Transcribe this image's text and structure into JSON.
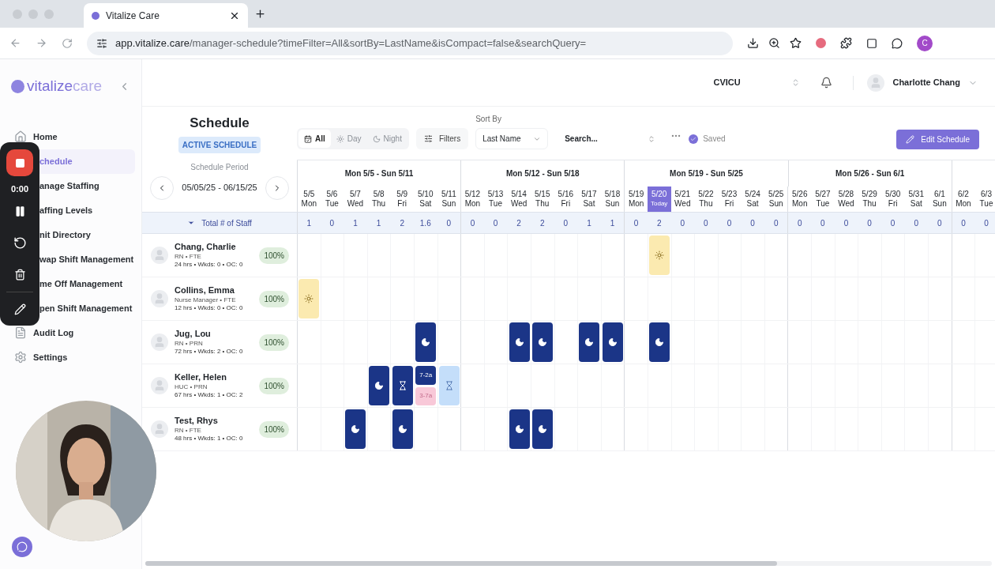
{
  "browser": {
    "tab_title": "Vitalize Care",
    "url_host": "app.vitalize.care",
    "url_path": "/manager-schedule?timeFilter=All&sortBy=LastName&isCompact=false&searchQuery=",
    "profile_initial": "C"
  },
  "sidebar": {
    "logo_main": "vitalize",
    "logo_accent": "care",
    "items": [
      {
        "label": "Home",
        "selected": false,
        "covered": false
      },
      {
        "label": "chedule",
        "selected": true,
        "covered": true
      },
      {
        "label": "anage Staffing",
        "selected": false,
        "covered": true
      },
      {
        "label": "affing Levels",
        "selected": false,
        "covered": true
      },
      {
        "label": "nit Directory",
        "selected": false,
        "covered": true
      },
      {
        "label": "wap Shift Management",
        "selected": false,
        "covered": true
      },
      {
        "label": "me Off Management",
        "selected": false,
        "covered": true
      },
      {
        "label": "pen Shift Management",
        "selected": false,
        "covered": true
      },
      {
        "label": "Audit Log",
        "selected": false,
        "covered": false
      },
      {
        "label": "Settings",
        "selected": false,
        "covered": false
      }
    ]
  },
  "recorder": {
    "timer": "0:00"
  },
  "topbar": {
    "unit": "CVICU",
    "user": "Charlotte Chang"
  },
  "schedule": {
    "title": "Schedule",
    "badge": "ACTIVE SCHEDULE",
    "period_label": "Schedule Period",
    "period": "05/05/25 - 06/15/25"
  },
  "toolbar": {
    "time_filters": [
      {
        "label": "All",
        "selected": true
      },
      {
        "label": "Day",
        "selected": false
      },
      {
        "label": "Night",
        "selected": false
      }
    ],
    "filters": "Filters",
    "sort_label": "Sort By",
    "sort_value": "Last Name",
    "search_placeholder": "Search...",
    "saved": "Saved",
    "edit": "Edit Schedule"
  },
  "weeks": [
    "Mon 5/5 - Sun 5/11",
    "Mon 5/12 - Sun 5/18",
    "Mon 5/19 - Sun 5/25",
    "Mon 5/26 - Sun 6/1"
  ],
  "days": [
    {
      "date": "5/5",
      "weekday": "Mon",
      "today": false,
      "total": "1"
    },
    {
      "date": "5/6",
      "weekday": "Tue",
      "today": false,
      "total": "0"
    },
    {
      "date": "5/7",
      "weekday": "Wed",
      "today": false,
      "total": "1"
    },
    {
      "date": "5/8",
      "weekday": "Thu",
      "today": false,
      "total": "1"
    },
    {
      "date": "5/9",
      "weekday": "Fri",
      "today": false,
      "total": "2"
    },
    {
      "date": "5/10",
      "weekday": "Sat",
      "today": false,
      "total": "1.6"
    },
    {
      "date": "5/11",
      "weekday": "Sun",
      "today": false,
      "total": "0"
    },
    {
      "date": "5/12",
      "weekday": "Mon",
      "today": false,
      "total": "0"
    },
    {
      "date": "5/13",
      "weekday": "Tue",
      "today": false,
      "total": "0"
    },
    {
      "date": "5/14",
      "weekday": "Wed",
      "today": false,
      "total": "2"
    },
    {
      "date": "5/15",
      "weekday": "Thu",
      "today": false,
      "total": "2"
    },
    {
      "date": "5/16",
      "weekday": "Fri",
      "today": false,
      "total": "0"
    },
    {
      "date": "5/17",
      "weekday": "Sat",
      "today": false,
      "total": "1"
    },
    {
      "date": "5/18",
      "weekday": "Sun",
      "today": false,
      "total": "1"
    },
    {
      "date": "5/19",
      "weekday": "Mon",
      "today": false,
      "total": "0"
    },
    {
      "date": "5/20",
      "weekday": "Today",
      "today": true,
      "total": "2"
    },
    {
      "date": "5/21",
      "weekday": "Wed",
      "today": false,
      "total": "0"
    },
    {
      "date": "5/22",
      "weekday": "Thu",
      "today": false,
      "total": "0"
    },
    {
      "date": "5/23",
      "weekday": "Fri",
      "today": false,
      "total": "0"
    },
    {
      "date": "5/24",
      "weekday": "Sat",
      "today": false,
      "total": "0"
    },
    {
      "date": "5/25",
      "weekday": "Sun",
      "today": false,
      "total": "0"
    },
    {
      "date": "5/26",
      "weekday": "Mon",
      "today": false,
      "total": "0"
    },
    {
      "date": "5/27",
      "weekday": "Tue",
      "today": false,
      "total": "0"
    },
    {
      "date": "5/28",
      "weekday": "Wed",
      "today": false,
      "total": "0"
    },
    {
      "date": "5/29",
      "weekday": "Thu",
      "today": false,
      "total": "0"
    },
    {
      "date": "5/30",
      "weekday": "Fri",
      "today": false,
      "total": "0"
    },
    {
      "date": "5/31",
      "weekday": "Sat",
      "today": false,
      "total": "0"
    },
    {
      "date": "6/1",
      "weekday": "Sun",
      "today": false,
      "total": "0"
    },
    {
      "date": "6/2",
      "weekday": "Mon",
      "today": false,
      "total": "0"
    },
    {
      "date": "6/3",
      "weekday": "Tue",
      "today": false,
      "total": "0"
    }
  ],
  "totals_label": "Total # of Staff",
  "staff": [
    {
      "name": "Chang, Charlie",
      "role": "RN • FTE",
      "stats": "24 hrs • Wkds: 0 • OC: 0",
      "percent": "100%",
      "cells": [
        {
          "kind": "none"
        },
        {
          "kind": "none"
        },
        {
          "kind": "none"
        },
        {
          "kind": "none"
        },
        {
          "kind": "none"
        },
        {
          "kind": "none"
        },
        {
          "kind": "none"
        },
        {
          "kind": "none"
        },
        {
          "kind": "none"
        },
        {
          "kind": "none"
        },
        {
          "kind": "none"
        },
        {
          "kind": "none"
        },
        {
          "kind": "none"
        },
        {
          "kind": "none"
        },
        {
          "kind": "none"
        },
        {
          "kind": "day"
        },
        {
          "kind": "none"
        },
        {
          "kind": "none"
        },
        {
          "kind": "none"
        },
        {
          "kind": "none"
        },
        {
          "kind": "none"
        },
        {
          "kind": "none"
        },
        {
          "kind": "none"
        },
        {
          "kind": "none"
        },
        {
          "kind": "none"
        },
        {
          "kind": "none"
        },
        {
          "kind": "none"
        },
        {
          "kind": "none"
        },
        {
          "kind": "none"
        },
        {
          "kind": "none"
        }
      ]
    },
    {
      "name": "Collins, Emma",
      "role": "Nurse Manager • FTE",
      "stats": "12 hrs • Wkds: 0 • OC: 0",
      "percent": "100%",
      "cells": [
        {
          "kind": "day"
        },
        {
          "kind": "none"
        },
        {
          "kind": "none"
        },
        {
          "kind": "none"
        },
        {
          "kind": "none"
        },
        {
          "kind": "none"
        },
        {
          "kind": "none"
        },
        {
          "kind": "none"
        },
        {
          "kind": "none"
        },
        {
          "kind": "none"
        },
        {
          "kind": "none"
        },
        {
          "kind": "none"
        },
        {
          "kind": "none"
        },
        {
          "kind": "none"
        },
        {
          "kind": "none"
        },
        {
          "kind": "none"
        },
        {
          "kind": "none"
        },
        {
          "kind": "none"
        },
        {
          "kind": "none"
        },
        {
          "kind": "none"
        },
        {
          "kind": "none"
        },
        {
          "kind": "none"
        },
        {
          "kind": "none"
        },
        {
          "kind": "none"
        },
        {
          "kind": "none"
        },
        {
          "kind": "none"
        },
        {
          "kind": "none"
        },
        {
          "kind": "none"
        },
        {
          "kind": "none"
        },
        {
          "kind": "none"
        }
      ]
    },
    {
      "name": "Jug, Lou",
      "role": "RN • PRN",
      "stats": "72 hrs • Wkds: 2 • OC: 0",
      "percent": "100%",
      "cells": [
        {
          "kind": "none"
        },
        {
          "kind": "none"
        },
        {
          "kind": "none"
        },
        {
          "kind": "none"
        },
        {
          "kind": "none"
        },
        {
          "kind": "night"
        },
        {
          "kind": "none"
        },
        {
          "kind": "none"
        },
        {
          "kind": "none"
        },
        {
          "kind": "night"
        },
        {
          "kind": "night"
        },
        {
          "kind": "none"
        },
        {
          "kind": "night"
        },
        {
          "kind": "night"
        },
        {
          "kind": "none"
        },
        {
          "kind": "night"
        },
        {
          "kind": "none"
        },
        {
          "kind": "none"
        },
        {
          "kind": "none"
        },
        {
          "kind": "none"
        },
        {
          "kind": "none"
        },
        {
          "kind": "none"
        },
        {
          "kind": "none"
        },
        {
          "kind": "none"
        },
        {
          "kind": "none"
        },
        {
          "kind": "none"
        },
        {
          "kind": "none"
        },
        {
          "kind": "none"
        },
        {
          "kind": "none"
        },
        {
          "kind": "none"
        }
      ]
    },
    {
      "name": "Keller, Helen",
      "role": "HUC • PRN",
      "stats": "67 hrs • Wkds: 1 • OC: 2",
      "percent": "100%",
      "cells": [
        {
          "kind": "none"
        },
        {
          "kind": "none"
        },
        {
          "kind": "none"
        },
        {
          "kind": "night"
        },
        {
          "kind": "oncall"
        },
        {
          "kind": "split",
          "parts": [
            {
              "label": "7-2a",
              "kind": "night"
            },
            {
              "label": "3-7a",
              "kind": "evening"
            }
          ]
        },
        {
          "kind": "oncall-light"
        },
        {
          "kind": "none"
        },
        {
          "kind": "none"
        },
        {
          "kind": "none"
        },
        {
          "kind": "none"
        },
        {
          "kind": "none"
        },
        {
          "kind": "none"
        },
        {
          "kind": "none"
        },
        {
          "kind": "none"
        },
        {
          "kind": "none"
        },
        {
          "kind": "none"
        },
        {
          "kind": "none"
        },
        {
          "kind": "none"
        },
        {
          "kind": "none"
        },
        {
          "kind": "none"
        },
        {
          "kind": "none"
        },
        {
          "kind": "none"
        },
        {
          "kind": "none"
        },
        {
          "kind": "none"
        },
        {
          "kind": "none"
        },
        {
          "kind": "none"
        },
        {
          "kind": "none"
        },
        {
          "kind": "none"
        },
        {
          "kind": "none"
        }
      ]
    },
    {
      "name": "Test, Rhys",
      "role": "RN • FTE",
      "stats": "48 hrs • Wkds: 1 • OC: 0",
      "percent": "100%",
      "cells": [
        {
          "kind": "none"
        },
        {
          "kind": "none"
        },
        {
          "kind": "night"
        },
        {
          "kind": "none"
        },
        {
          "kind": "night"
        },
        {
          "kind": "none"
        },
        {
          "kind": "none"
        },
        {
          "kind": "none"
        },
        {
          "kind": "none"
        },
        {
          "kind": "night"
        },
        {
          "kind": "night"
        },
        {
          "kind": "none"
        },
        {
          "kind": "none"
        },
        {
          "kind": "none"
        },
        {
          "kind": "none"
        },
        {
          "kind": "none"
        },
        {
          "kind": "none"
        },
        {
          "kind": "none"
        },
        {
          "kind": "none"
        },
        {
          "kind": "none"
        },
        {
          "kind": "none"
        },
        {
          "kind": "none"
        },
        {
          "kind": "none"
        },
        {
          "kind": "none"
        },
        {
          "kind": "none"
        },
        {
          "kind": "none"
        },
        {
          "kind": "none"
        },
        {
          "kind": "none"
        },
        {
          "kind": "none"
        },
        {
          "kind": "none"
        }
      ]
    }
  ]
}
